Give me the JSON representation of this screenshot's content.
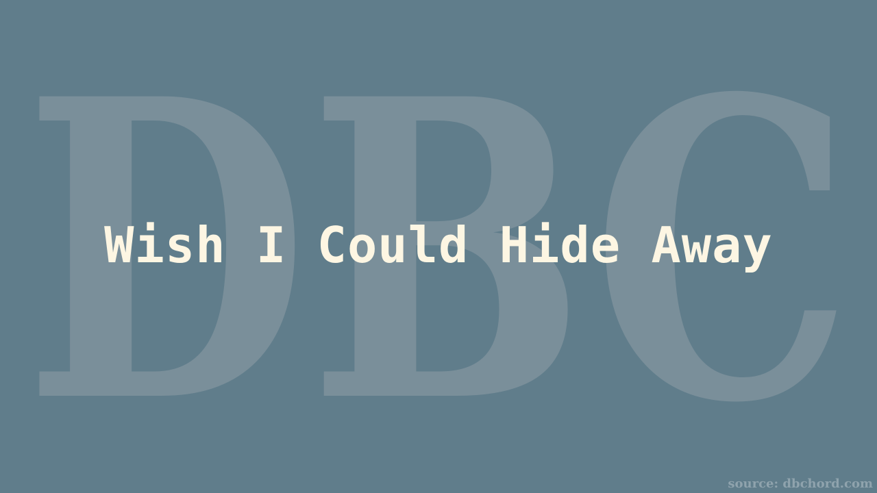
{
  "background_color": "#607d8b",
  "watermark": {
    "text": "DBC",
    "color": "#7a8f9a"
  },
  "title": {
    "text": "Wish I Could Hide Away",
    "color": "#fdf6e3"
  },
  "source": {
    "text": "source: dbchord.com"
  }
}
